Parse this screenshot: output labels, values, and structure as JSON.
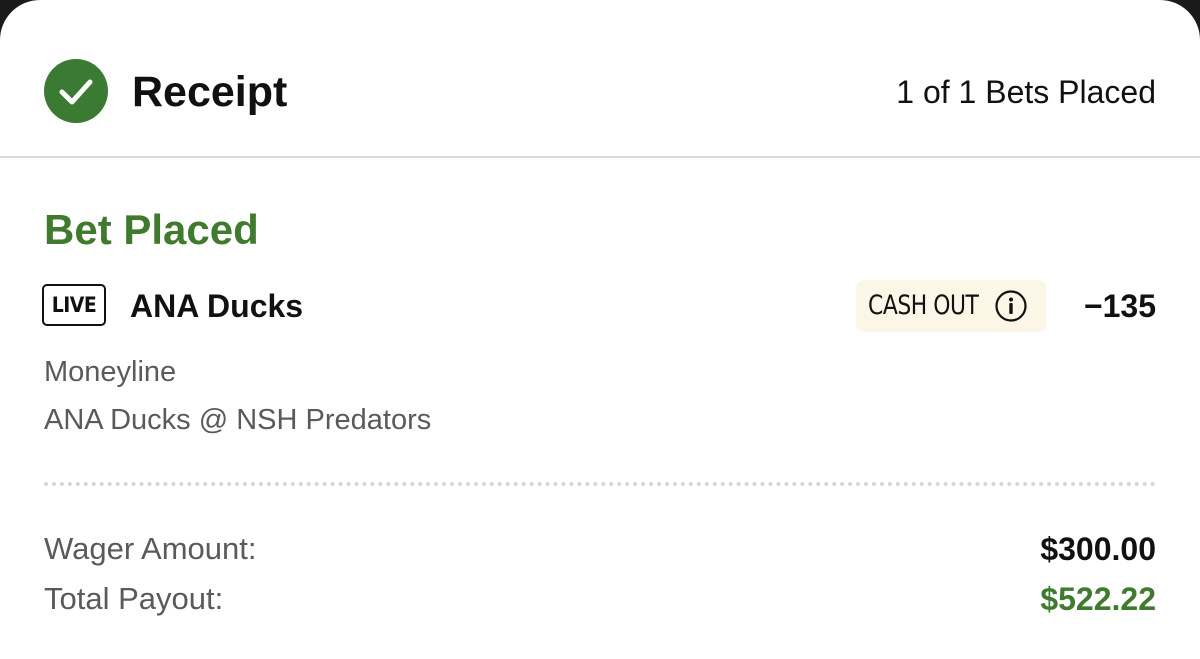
{
  "receipt": {
    "title": "Receipt",
    "bets_placed": "1 of 1 Bets Placed",
    "icon": "check-circle-icon",
    "accent_color": "#3a7a32"
  },
  "bet": {
    "status": "Bet Placed",
    "live_badge": "LIVE",
    "selection": "ANA Ducks",
    "cash_out_label": "CASH OUT",
    "cash_out_icon": "info-icon",
    "odds": "−135",
    "market": "Moneyline",
    "matchup": "ANA Ducks @ NSH Predators"
  },
  "summary": {
    "wager_label": "Wager Amount:",
    "wager_value": "$300.00",
    "payout_label": "Total Payout:",
    "payout_value": "$522.22",
    "payout_color": "#3f7a2e"
  }
}
